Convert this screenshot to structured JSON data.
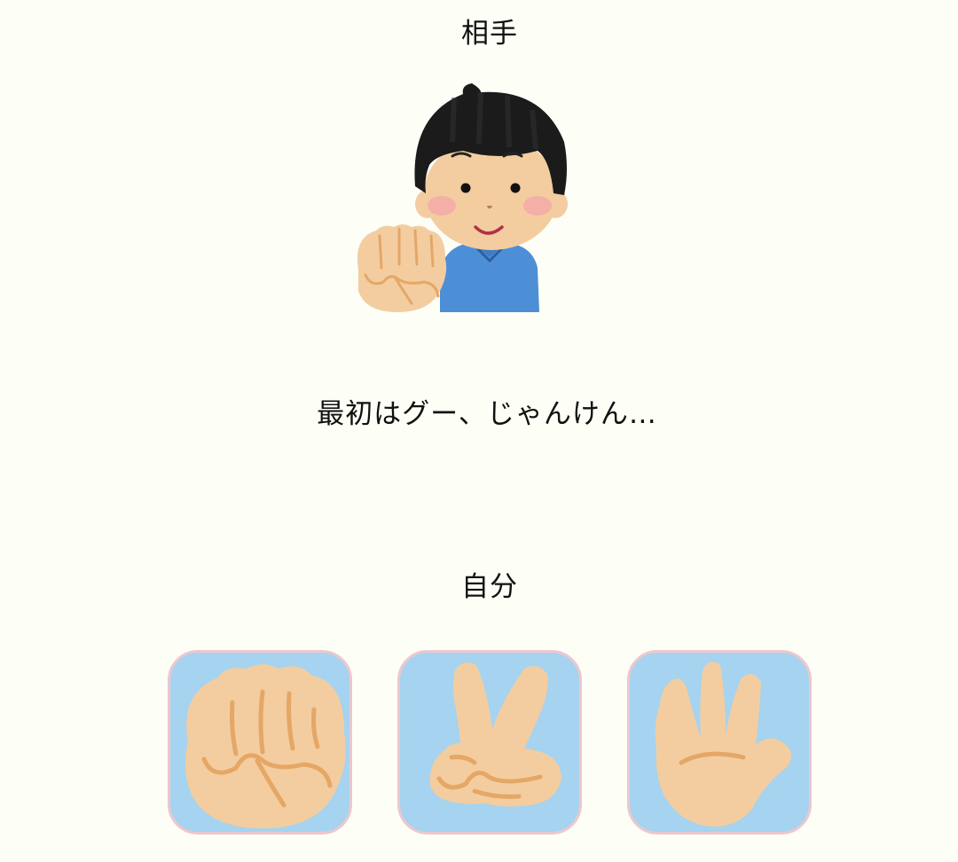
{
  "opponent": {
    "label": "相手",
    "current_hand": "rock",
    "illustration": "boy-showing-rock-hand"
  },
  "message": "最初はグー、じゃんけん…",
  "player": {
    "label": "自分",
    "choices": [
      {
        "id": "rock",
        "icon": "rock-hand-icon"
      },
      {
        "id": "scissors",
        "icon": "scissors-hand-icon"
      },
      {
        "id": "paper",
        "icon": "paper-hand-icon"
      }
    ]
  },
  "colors": {
    "background": "#fdfef6",
    "button_fill": "#a6d3ef",
    "button_border": "#ecc7cf",
    "skin": "#f3cda0",
    "skin_line": "#e5a766",
    "shirt": "#4d8fd6",
    "hair": "#1b1b1b"
  }
}
